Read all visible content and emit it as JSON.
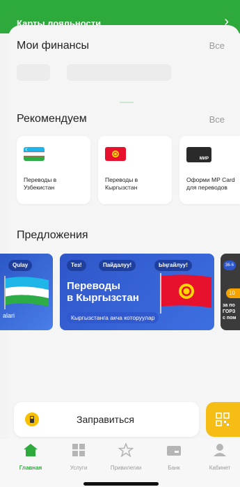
{
  "header": {
    "title": "Карты лояльности",
    "chevron_icon": "chevron-right-icon"
  },
  "finances": {
    "title": "Мои финансы",
    "all_label": "Все"
  },
  "recommend": {
    "title": "Рекомендуем",
    "all_label": "Все",
    "items": [
      {
        "label": "Переводы в\nУзбекистан",
        "icon": "uzbekistan-flag-icon"
      },
      {
        "label": "Переводы в\nКыргызстан",
        "icon": "kyrgyzstan-flag-icon"
      },
      {
        "label": "Оформи МР Card\nдля переводов",
        "icon": "mir-card-icon"
      }
    ]
  },
  "offers": {
    "title": "Предложения",
    "left": {
      "pill": "Qulay",
      "tail": "alari"
    },
    "main": {
      "pills": [
        "Тез!",
        "Пайдалуу!",
        "Ыңгайлуу!"
      ],
      "headline": "Переводы\nв Кыргызстан",
      "sub": "Кыргызстанга акча которуулар"
    },
    "right": {
      "badge": "36·6",
      "tag": "10",
      "lines": "за по\nГОРЗ\nс пом"
    }
  },
  "action": {
    "label": "Заправиться",
    "icon": "fuel-icon",
    "qr_icon": "qr-code-icon"
  },
  "nav": [
    {
      "label": "Главная",
      "icon": "home-icon",
      "active": true
    },
    {
      "label": "Услуги",
      "icon": "grid-icon",
      "active": false
    },
    {
      "label": "Привилегии",
      "icon": "star-icon",
      "active": false
    },
    {
      "label": "Банк",
      "icon": "bank-card-icon",
      "active": false
    },
    {
      "label": "Кабинет",
      "icon": "profile-icon",
      "active": false
    }
  ],
  "colors": {
    "brand": "#2eaa3c",
    "accent_yellow": "#f6bd14",
    "offer_blue": "#2f56c9"
  }
}
